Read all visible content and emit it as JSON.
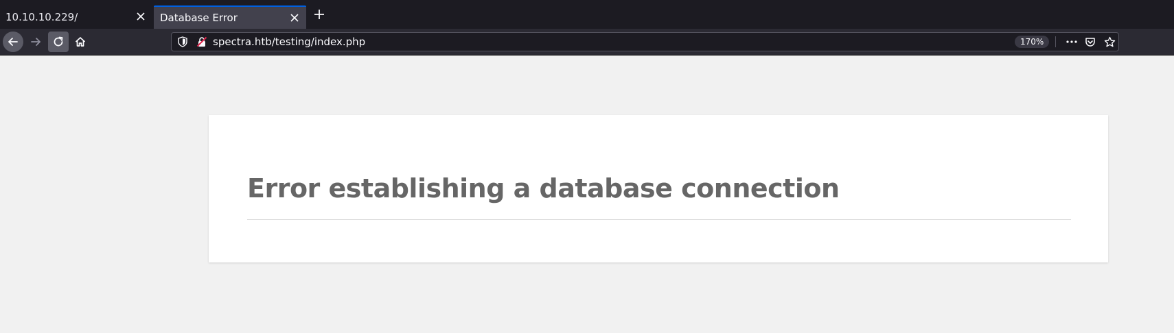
{
  "tabs": [
    {
      "title": "10.10.10.229/",
      "active": false
    },
    {
      "title": "Database Error",
      "active": true
    }
  ],
  "navbar": {
    "url": "spectra.htb/testing/index.php",
    "zoom": "170%"
  },
  "page": {
    "heading": "Error establishing a database connection"
  },
  "colors": {
    "tabbar_bg": "#1c1b22",
    "active_tab_bg": "#42414d",
    "active_tab_accent": "#0060df",
    "navbar_bg": "#2b2a33",
    "page_bg": "#f1f1f1",
    "card_bg": "#ffffff",
    "heading": "#666666",
    "insecure_lock": "#e22850"
  },
  "icons": {
    "tab_close": "close-icon",
    "new_tab": "plus-icon",
    "back": "arrow-left-icon",
    "forward": "arrow-right-icon",
    "reload": "reload-icon",
    "home": "home-icon",
    "tracking": "shield-icon",
    "insecure": "insecure-lock-icon",
    "more": "more-horizontal-icon",
    "pocket": "pocket-icon",
    "bookmark": "star-icon"
  }
}
